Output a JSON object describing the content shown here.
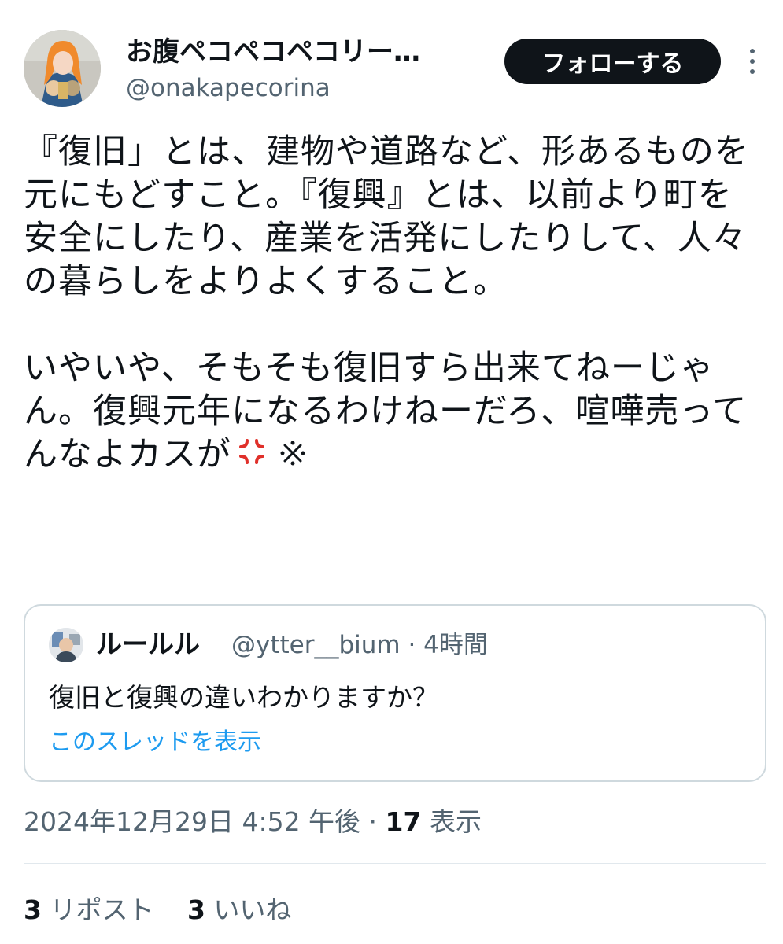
{
  "author": {
    "display_name": "お腹ペコペコペコリー…",
    "handle": "@onakapecorina"
  },
  "follow_label": "フォローする",
  "tweet_text": "『復旧」とは、建物や道路など、形あるものを元にもどすこと。『復興』とは、以前より町を安全にしたり、産業を活発にしたりして、人々の暮らしをよりよくすること。\n\nいやいや、そもそも復旧すら出来てねーじゃん。復興元年になるわけねーだろ、喧嘩売ってんなよカスが",
  "tweet_emojis": [
    "anger-icon",
    "anger-symbol-icon"
  ],
  "quote": {
    "display_name": "ルールル",
    "meta": "@ytter__bium · 4時間",
    "text": "復旧と復興の違いわかりますか？",
    "thread_link": "このスレッドを表示"
  },
  "timestamp": {
    "date": "2024年12月29日 4:52 午後 · ",
    "views_count": "17",
    "views_label": " 表示"
  },
  "stats": {
    "reposts_count": "3",
    "reposts_label": " リポスト",
    "likes_count": "3",
    "likes_label": " いいね"
  },
  "colors": {
    "text": "#0f1419",
    "secondary": "#536471",
    "link": "#1d9bf0",
    "follow_bg": "#0f1419",
    "anger": "#e0302a"
  }
}
